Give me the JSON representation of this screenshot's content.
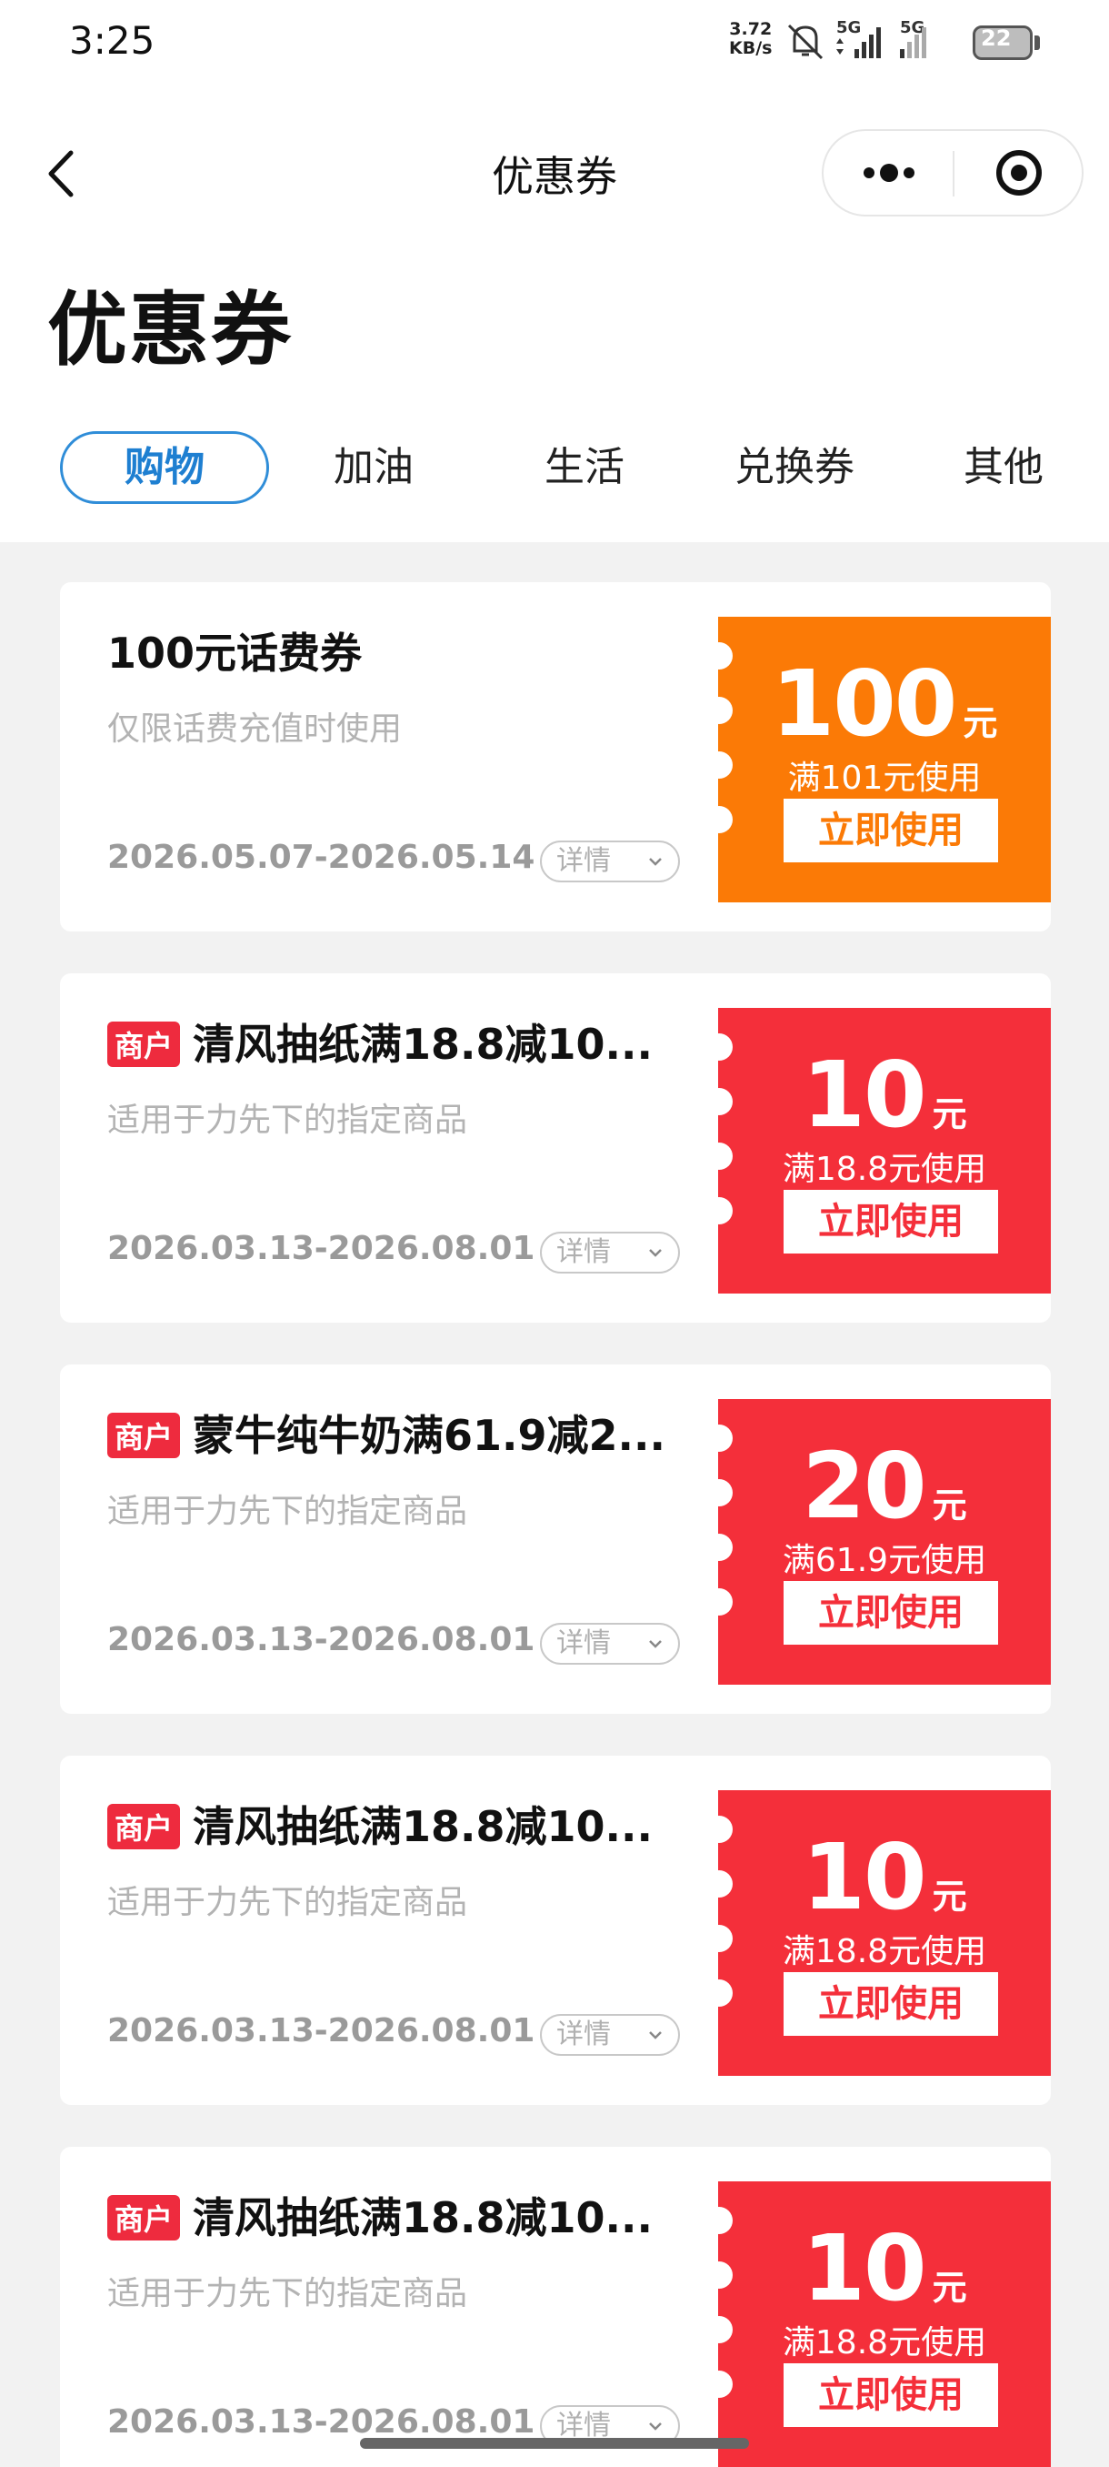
{
  "status_bar": {
    "time": "3:25",
    "net_speed_value": "3.72",
    "net_speed_unit": "KB/s",
    "signal_1": "5G",
    "signal_2": "5G",
    "battery": "22"
  },
  "nav": {
    "title": "优惠券",
    "back_icon": "chevron-left-icon",
    "more_icon": "more-dots-icon",
    "close_icon": "target-circle-icon"
  },
  "page_title": "优惠券",
  "tabs": [
    {
      "label": "购物",
      "active": true
    },
    {
      "label": "加油",
      "active": false
    },
    {
      "label": "生活",
      "active": false
    },
    {
      "label": "兑换券",
      "active": false
    },
    {
      "label": "其他",
      "active": false
    }
  ],
  "coupons": [
    {
      "tag": "",
      "title": "100元话费券",
      "subtitle": "仅限话费充值时使用",
      "date": "2026.05.07-2026.05.14",
      "detail_label": "详情",
      "amount": "100",
      "unit": "元",
      "condition": "满101元使用",
      "button": "立即使用",
      "color": "#fb7a06"
    },
    {
      "tag": "商户",
      "title": "清风抽纸满18.8减10...",
      "subtitle": "适用于力先下的指定商品",
      "date": "2026.03.13-2026.08.01",
      "detail_label": "详情",
      "amount": "10",
      "unit": "元",
      "condition": "满18.8元使用",
      "button": "立即使用",
      "color": "#f42f3a"
    },
    {
      "tag": "商户",
      "title": "蒙牛纯牛奶满61.9减2...",
      "subtitle": "适用于力先下的指定商品",
      "date": "2026.03.13-2026.08.01",
      "detail_label": "详情",
      "amount": "20",
      "unit": "元",
      "condition": "满61.9元使用",
      "button": "立即使用",
      "color": "#f42f3a"
    },
    {
      "tag": "商户",
      "title": "清风抽纸满18.8减10...",
      "subtitle": "适用于力先下的指定商品",
      "date": "2026.03.13-2026.08.01",
      "detail_label": "详情",
      "amount": "10",
      "unit": "元",
      "condition": "满18.8元使用",
      "button": "立即使用",
      "color": "#f42f3a"
    },
    {
      "tag": "商户",
      "title": "清风抽纸满18.8减10...",
      "subtitle": "适用于力先下的指定商品",
      "date": "2026.03.13-2026.08.01",
      "detail_label": "详情",
      "amount": "10",
      "unit": "元",
      "condition": "满18.8元使用",
      "button": "立即使用",
      "color": "#f42f3a"
    }
  ]
}
